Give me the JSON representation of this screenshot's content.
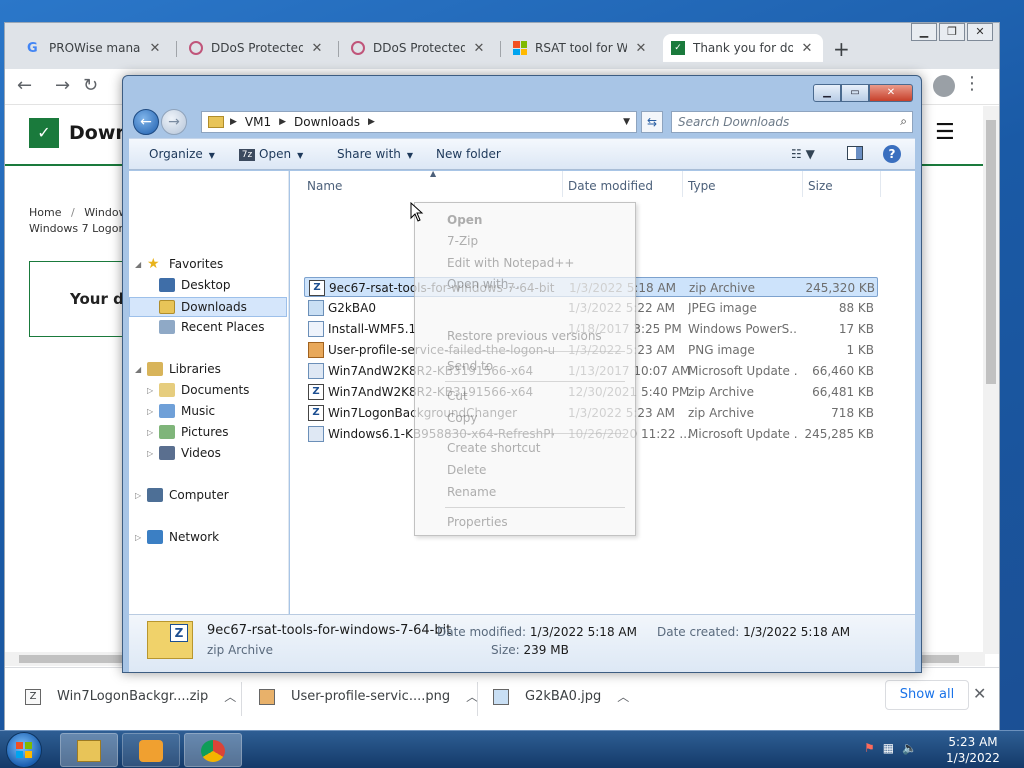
{
  "browser": {
    "tabs": [
      {
        "label": "PROWise manage",
        "favicon": "google-g"
      },
      {
        "label": "DDoS Protected H",
        "favicon": "ddos-shield"
      },
      {
        "label": "DDoS Protected H",
        "favicon": "ddos-shield"
      },
      {
        "label": "RSAT tool for Win",
        "favicon": "microsoft-logo"
      },
      {
        "label": "Thank you for do",
        "favicon": "download-site"
      }
    ],
    "new_tab_symbol": "+"
  },
  "webpage": {
    "site_name": "Down",
    "breadcrumb_home": "Home",
    "breadcrumb_sep": "/",
    "breadcrumb_next": "Window",
    "breadcrumb_line2": "Windows 7 Logon",
    "download_box_text": "Your do"
  },
  "explorer": {
    "address": [
      "VM1",
      "Downloads"
    ],
    "search_placeholder": "Search Downloads",
    "commands": {
      "organize": "Organize",
      "open": "Open",
      "share_with": "Share with",
      "new_folder": "New folder"
    },
    "nav": {
      "favorites": "Favorites",
      "desktop": "Desktop",
      "downloads": "Downloads",
      "recent_places": "Recent Places",
      "libraries": "Libraries",
      "documents": "Documents",
      "music": "Music",
      "pictures": "Pictures",
      "videos": "Videos",
      "computer": "Computer",
      "network": "Network"
    },
    "columns": {
      "name": "Name",
      "date_modified": "Date modified",
      "type": "Type",
      "size": "Size"
    },
    "files": [
      {
        "name": "9ec67-rsat-tools-for-windows-7-64-bit",
        "date": "1/3/2022 5:18 AM",
        "type": "zip Archive",
        "size": "245,320 KB",
        "icon": "zip-icon"
      },
      {
        "name": "G2kBA0",
        "date": "1/3/2022 5:22 AM",
        "type": "JPEG image",
        "size": "88 KB",
        "icon": "image-icon"
      },
      {
        "name": "Install-WMF5.1",
        "date": "1/18/2017 3:25 PM",
        "type": "Windows PowerS...",
        "size": "17 KB",
        "icon": "script-icon"
      },
      {
        "name": "User-profile-service-failed-the-logon-us...",
        "date": "1/3/2022 5:23 AM",
        "type": "PNG image",
        "size": "1 KB",
        "icon": "png-icon"
      },
      {
        "name": "Win7AndW2K8R2-KB3191566-x64",
        "date": "1/13/2017 10:07 AM",
        "type": "Microsoft Update ...",
        "size": "66,460 KB",
        "icon": "update-icon"
      },
      {
        "name": "Win7AndW2K8R2-KB3191566-x64",
        "date": "12/30/2021 5:40 PM",
        "type": "zip Archive",
        "size": "66,481 KB",
        "icon": "zip-icon"
      },
      {
        "name": "Win7LogonBackgroundChanger",
        "date": "1/3/2022 5:23 AM",
        "type": "zip Archive",
        "size": "718 KB",
        "icon": "zip-icon"
      },
      {
        "name": "Windows6.1-KB958830-x64-RefreshPkg",
        "date": "10/26/2020 11:22 ...",
        "type": "Microsoft Update ...",
        "size": "245,285 KB",
        "icon": "update-icon"
      }
    ],
    "context_menu": {
      "open": "Open",
      "seven_zip": "7-Zip",
      "edit_notepad": "Edit with Notepad++",
      "open_with": "Open with...",
      "restore": "Restore previous versions",
      "send_to": "Send to",
      "cut": "Cut",
      "copy": "Copy",
      "create_shortcut": "Create shortcut",
      "delete": "Delete",
      "rename": "Rename",
      "properties": "Properties"
    },
    "details": {
      "name": "9ec67-rsat-tools-for-windows-7-64-bit",
      "type": "zip Archive",
      "date_modified_label": "Date modified:",
      "date_modified": "1/3/2022 5:18 AM",
      "size_label": "Size:",
      "size": "239 MB",
      "date_created_label": "Date created:",
      "date_created": "1/3/2022 5:18 AM"
    }
  },
  "downloads_bar": {
    "items": [
      "Win7LogonBackgr....zip",
      "User-profile-servic....png",
      "G2kBA0.jpg"
    ],
    "show_all": "Show all"
  },
  "taskbar": {
    "time": "5:23 AM",
    "date": "1/3/2022"
  },
  "colors": {
    "site_green": "#1a7a3c",
    "selection_blue": "#cde3fb",
    "chrome_tabstrip": "#dfe3e8",
    "link_blue": "#1a73e8"
  }
}
